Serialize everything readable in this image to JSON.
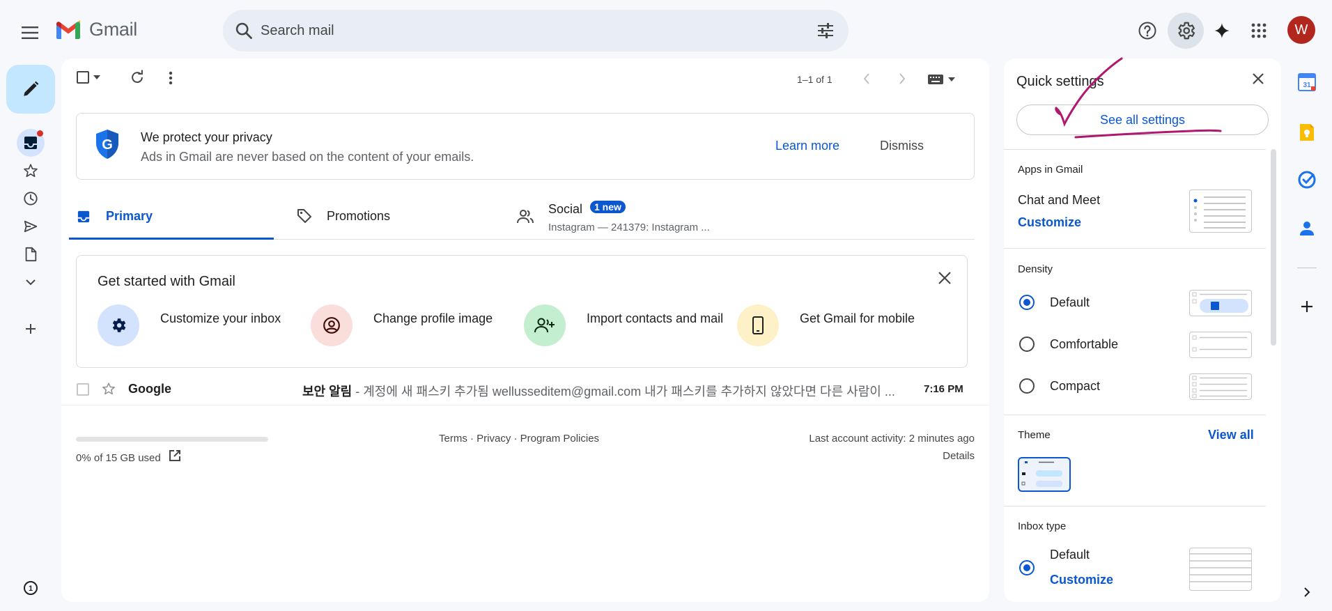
{
  "header": {
    "app_name": "Gmail",
    "search_placeholder": "Search mail",
    "avatar_initial": "W",
    "icons": [
      "menu-icon",
      "search-icon",
      "search-options-icon",
      "help-icon",
      "settings-icon",
      "gemini-icon",
      "apps-icon"
    ]
  },
  "nav": {
    "items": [
      "inbox",
      "starred",
      "snoozed",
      "sent",
      "drafts",
      "more"
    ],
    "inbox_has_unread": true
  },
  "toolbar": {
    "pagination": "1–1 of 1"
  },
  "privacy_banner": {
    "title": "We protect your privacy",
    "description": "Ads in Gmail are never based on the content of your emails.",
    "learn_more": "Learn more",
    "dismiss": "Dismiss"
  },
  "tabs": [
    {
      "label": "Primary",
      "selected": true
    },
    {
      "label": "Promotions",
      "selected": false
    },
    {
      "label": "Social",
      "selected": false,
      "badge": "1 new",
      "subtext": "Instagram — 241379: Instagram ..."
    }
  ],
  "get_started": {
    "title": "Get started with Gmail",
    "items": [
      {
        "label": "Customize your inbox",
        "color": "#d3e3fd"
      },
      {
        "label": "Change profile image",
        "color": "#f9dedc"
      },
      {
        "label": "Import contacts and mail",
        "color": "#c4eed0"
      },
      {
        "label": "Get Gmail for mobile",
        "color": "#fef0c7"
      }
    ]
  },
  "emails": [
    {
      "sender": "Google",
      "subject": "보안 알림",
      "snippet": " - 계정에 새 패스키 추가됨 wellusseditem@gmail.com 내가 패스키를 추가하지 않았다면 다른 사람이 ...",
      "time": "7:16 PM"
    }
  ],
  "footer": {
    "storage": "0% of 15 GB used",
    "storage_fraction": 0.0,
    "links": "Terms · Privacy · Program Policies",
    "last_activity": "Last account activity: 2 minutes ago",
    "details": "Details"
  },
  "quick_settings": {
    "title": "Quick settings",
    "see_all": "See all settings",
    "apps_section": "Apps in Gmail",
    "chat_meet": "Chat and Meet",
    "customize": "Customize",
    "density_section": "Density",
    "density_options": [
      {
        "label": "Default",
        "selected": true
      },
      {
        "label": "Comfortable",
        "selected": false
      },
      {
        "label": "Compact",
        "selected": false
      }
    ],
    "theme_section": "Theme",
    "view_all": "View all",
    "inbox_type_section": "Inbox type",
    "inbox_type_default": "Default",
    "inbox_customize": "Customize"
  },
  "colors": {
    "accent": "#0b57d0",
    "compose_bg": "#c2e7ff",
    "annotation": "#b0186f"
  },
  "side_panel": {
    "apps": [
      "calendar-icon",
      "keep-icon",
      "tasks-icon",
      "contacts-icon",
      "add-icon"
    ],
    "calendar_day": "31"
  }
}
